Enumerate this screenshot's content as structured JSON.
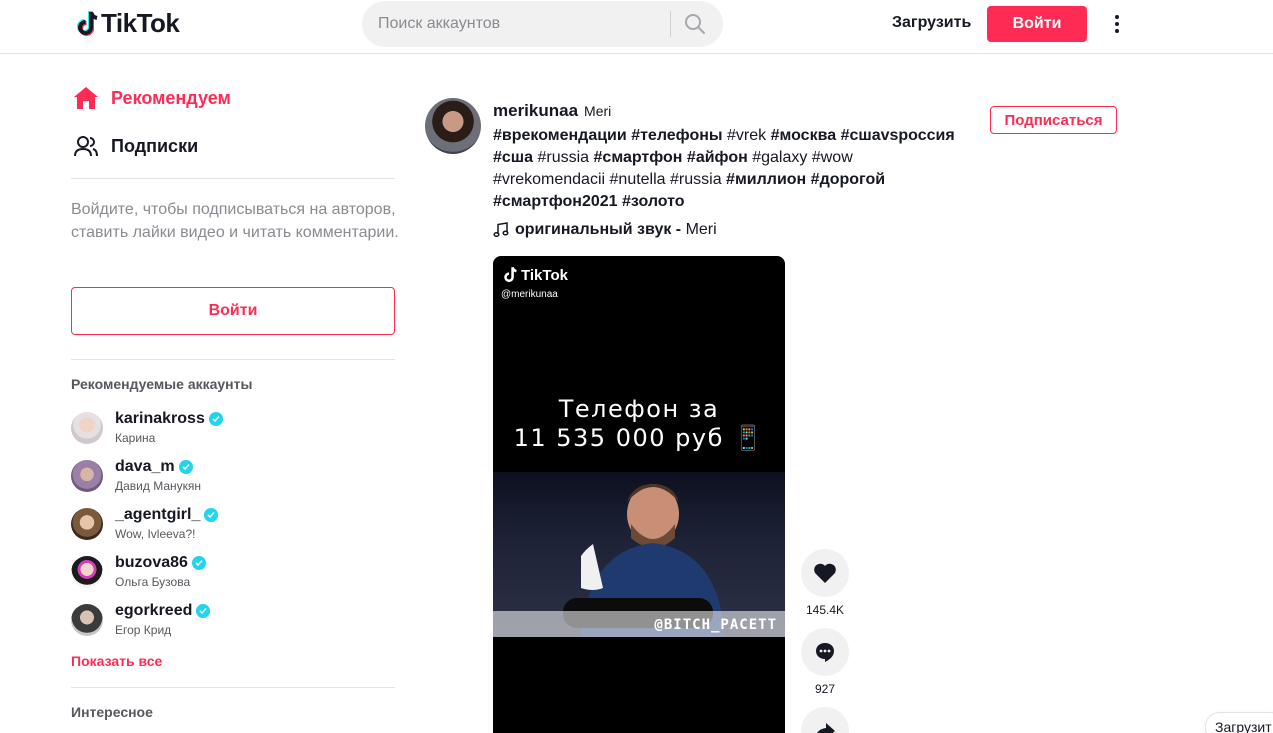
{
  "header": {
    "logo_text": "TikTok",
    "search_placeholder": "Поиск аккаунтов",
    "upload_label": "Загрузить",
    "login_label": "Войти"
  },
  "sidebar": {
    "nav": [
      {
        "label": "Рекомендуем",
        "icon": "home-icon",
        "active": true
      },
      {
        "label": "Подписки",
        "icon": "following-icon",
        "active": false
      }
    ],
    "login_hint": "Войдите, чтобы подписываться на авторов, ставить лайки видео и читать комментарии.",
    "login_button": "Войти",
    "suggested_title": "Рекомендуемые аккаунты",
    "accounts": [
      {
        "username": "karinakross",
        "display_name": "Карина",
        "verified": true
      },
      {
        "username": "dava_m",
        "display_name": "Давид Манукян",
        "verified": true
      },
      {
        "username": "_agentgirl_",
        "display_name": "Wow, Ivleeva?!",
        "verified": true
      },
      {
        "username": "buzova86",
        "display_name": "Ольга Бузова",
        "verified": true
      },
      {
        "username": "egorkreed",
        "display_name": "Егор Крид",
        "verified": true
      }
    ],
    "show_all": "Показать все",
    "discover_title": "Интересное"
  },
  "post": {
    "username": "merikunaa",
    "nickname": "Meri",
    "follow_label": "Подписаться",
    "hashtags": [
      {
        "text": "#врекомендации",
        "bold": true
      },
      {
        "text": "#телефоны",
        "bold": true
      },
      {
        "text": "#vrek",
        "bold": false
      },
      {
        "text": "#москва",
        "bold": true
      },
      {
        "text": "#сшаvsроссия",
        "bold": true
      },
      {
        "text": "#сша",
        "bold": true
      },
      {
        "text": "#russia",
        "bold": false
      },
      {
        "text": "#смартфон",
        "bold": true
      },
      {
        "text": "#айфон",
        "bold": true
      },
      {
        "text": "#galaxy",
        "bold": false
      },
      {
        "text": "#wow",
        "bold": false
      },
      {
        "text": "#vrekomendacii",
        "bold": false
      },
      {
        "text": "#nutella",
        "bold": false
      },
      {
        "text": "#russia",
        "bold": false
      },
      {
        "text": "#миллион",
        "bold": true
      },
      {
        "text": "#дорогой",
        "bold": true
      },
      {
        "text": "#смартфон2021",
        "bold": true
      },
      {
        "text": "#золото",
        "bold": true
      }
    ],
    "sound_title": "оригинальный звук - ",
    "sound_artist": "Meri",
    "video": {
      "watermark": "TikTok",
      "handle": "@merikunaa",
      "caption_line1": "Телефон за",
      "caption_line2": "11 535 000 руб 📱",
      "stamp": "@BITCH_PACETT"
    },
    "likes": "145.4K",
    "comments": "927"
  },
  "floating": {
    "upload_label": "Загрузит"
  },
  "colors": {
    "brand": "#fe2c55",
    "verified": "#20d5ec",
    "text": "#161823",
    "muted": "#8a8b91"
  }
}
